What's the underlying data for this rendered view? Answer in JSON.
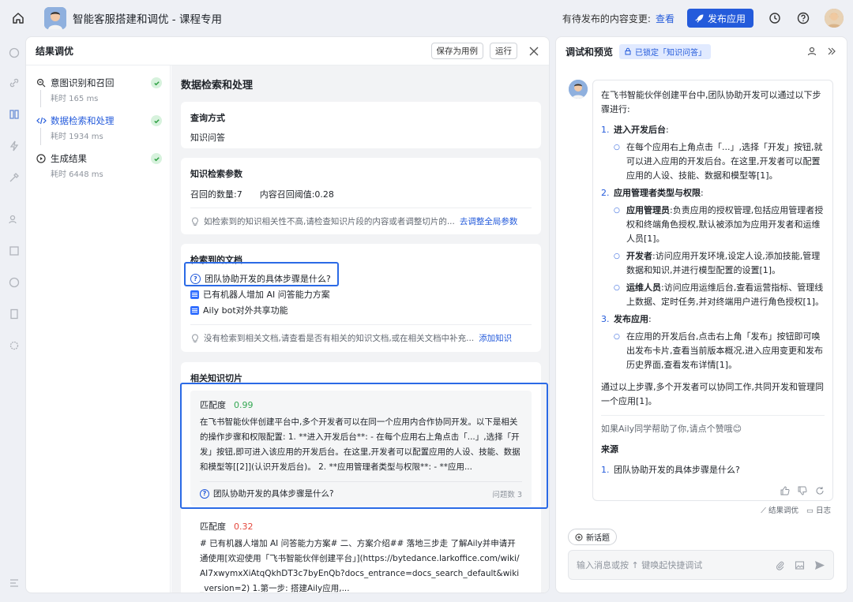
{
  "topbar": {
    "app_title": "智能客服搭建和调优 - 课程专用",
    "pending_text": "有待发布的内容变更:",
    "view_link": "查看",
    "publish_button": "发布应用"
  },
  "panel": {
    "title": "结果调优",
    "save_case": "保存为用例",
    "run": "运行"
  },
  "steps": [
    {
      "label": "意图识别和召回",
      "duration": "耗时 165 ms",
      "icon": "intent-icon"
    },
    {
      "label": "数据检索和处理",
      "duration": "耗时 1934 ms",
      "icon": "code-icon"
    },
    {
      "label": "生成结果",
      "duration": "耗时 6448 ms",
      "icon": "play-icon"
    }
  ],
  "main": {
    "title": "数据检索和处理",
    "query": {
      "title": "查询方式",
      "value": "知识问答"
    },
    "params": {
      "title": "知识检索参数",
      "count": "召回的数量:7",
      "threshold": "内容召回阈值:0.28",
      "hint": "如检索到的知识相关性不高,请检查知识片段的内容或者调整切片的...",
      "link": "去调整全局参数"
    },
    "docs": {
      "title": "检索到的文档",
      "items": [
        "团队协助开发的具体步骤是什么?",
        "已有机器人增加 AI 问答能力方案",
        "Aily bot对外共享功能"
      ],
      "hint": "没有检索到相关文档,请查看是否有相关的知识文档,或在相关文档中补充...",
      "link": "添加知识"
    },
    "fragments": {
      "title": "相关知识切片",
      "items": [
        {
          "score_label": "匹配度",
          "score": "0.99",
          "text": "在飞书智能伙伴创建平台中,多个开发者可以在同一个应用内合作协同开发。以下是相关的操作步骤和权限配置: 1. **进入开发后台**: - 在每个应用右上角点击「...」,选择「开发」按钮,即可进入该应用的开发后台。在这里,开发者可以配置应用的人设、技能、数据和模型等[[2]](认识开发后台)。 2. **应用管理者类型与权限**: - **应用...",
          "question": "团队协助开发的具体步骤是什么?",
          "qcount": "问题数 3"
        },
        {
          "score_label": "匹配度",
          "score": "0.32",
          "text": "# 已有机器人增加 AI 问答能力方案# 二、方案介绍## 落地三步走 了解Aily并申请开通使用[欢迎使用「飞书智能伙伴创建平台」](https://bytedance.larkoffice.com/wiki/AI7xwymxXiAtqQkhDT3c7byEnQb?docs_entrance=docs_search_default&wiki_version=2) 1.第一步: 搭建Aily应用,..."
        }
      ]
    }
  },
  "preview": {
    "title": "调试和预览",
    "lock_badge": "已锁定「知识问答」",
    "intro": "在飞书智能伙伴创建平台中,团队协助开发可以通过以下步骤进行:",
    "sections": [
      {
        "num": "1.",
        "title": "进入开发后台",
        "colon": ":",
        "bullets": [
          {
            "bold": "",
            "text": "在每个应用右上角点击「...」,选择「开发」按钮,就可以进入应用的开发后台。在这里,开发者可以配置应用的人设、技能、数据和模型等[1]。"
          }
        ]
      },
      {
        "num": "2.",
        "title": "应用管理者类型与权限",
        "colon": ":",
        "bullets": [
          {
            "bold": "应用管理员",
            "text": ":负责应用的授权管理,包括应用管理者授权和终端角色授权,默认被添加为应用开发者和运维人员[1]。"
          },
          {
            "bold": "开发者",
            "text": ":访问应用开发环境,设定人设,添加技能,管理数据和知识,并进行模型配置的设置[1]。"
          },
          {
            "bold": "运维人员",
            "text": ":访问应用运维后台,查看运营指标、管理线上数据、定时任务,并对终端用户进行角色授权[1]。"
          }
        ]
      },
      {
        "num": "3.",
        "title": "发布应用",
        "colon": ":",
        "bullets": [
          {
            "bold": "",
            "text": "在应用的开发后台,点击右上角「发布」按钮即可唤出发布卡片,查看当前版本概况,进入应用变更和发布历史界面,查看发布详情[1]。"
          }
        ]
      }
    ],
    "summary": "通过以上步骤,多个开发者可以协同工作,共同开发和管理同一个应用[1]。",
    "like_prompt": "如果Aily同学帮助了你,请点个赞哦😊",
    "source_title": "来源",
    "source_num": "1.",
    "source_item": "团队协助开发的具体步骤是什么?",
    "result_tune": "结果调优",
    "log": "日志",
    "new_topic": "新话题",
    "input_placeholder": "输入消息或按 ↑ 键唤起快捷调试"
  },
  "colors": {
    "accent": "#245bdb",
    "score_high": "#34a853",
    "score_low": "#e5483d",
    "highlight": "#2b6ae6"
  }
}
